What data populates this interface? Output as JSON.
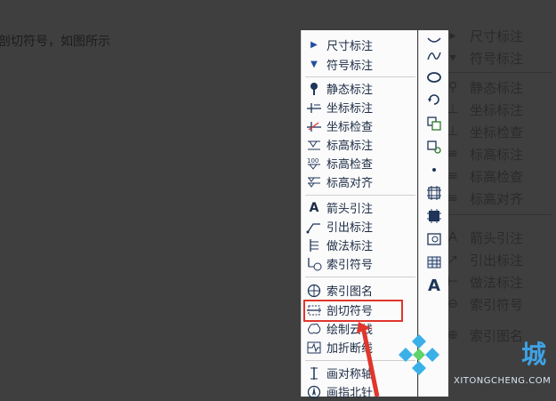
{
  "background_caption": "剖切符号，如图所示",
  "menu": {
    "items": [
      {
        "label": "尺寸标注",
        "icon": "triangle-right-icon"
      },
      {
        "label": "符号标注",
        "icon": "triangle-down-icon"
      },
      {
        "label": "静态标注",
        "icon": "pin-icon"
      },
      {
        "label": "坐标标注",
        "icon": "coordinate-icon"
      },
      {
        "label": "坐标检查",
        "icon": "coordinate-check-icon"
      },
      {
        "label": "标高标注",
        "icon": "elevation-icon"
      },
      {
        "label": "标高检查",
        "icon": "elevation-check-icon"
      },
      {
        "label": "标高对齐",
        "icon": "elevation-align-icon"
      },
      {
        "label": "箭头引注",
        "icon": "arrow-annotation-icon"
      },
      {
        "label": "引出标注",
        "icon": "leader-icon"
      },
      {
        "label": "做法标注",
        "icon": "method-icon"
      },
      {
        "label": "索引符号",
        "icon": "index-symbol-icon"
      },
      {
        "label": "索引图名",
        "icon": "index-name-icon"
      },
      {
        "label": "剖切符号",
        "icon": "section-symbol-icon"
      },
      {
        "label": "绘制云线",
        "icon": "cloud-line-icon"
      },
      {
        "label": "加折断线",
        "icon": "break-line-icon"
      },
      {
        "label": "画对称轴",
        "icon": "symmetry-axis-icon"
      },
      {
        "label": "画指北针",
        "icon": "north-arrow-icon"
      }
    ],
    "highlighted": "剖切符号",
    "highlight_color": "#e0362c"
  },
  "ghost_menu": {
    "items": [
      "尺寸标注",
      "符号标注",
      "静态标注",
      "坐标标注",
      "坐标检查",
      "标高标注",
      "标高检查",
      "标高对齐",
      "箭头引注",
      "引出标注",
      "做法标注",
      "索引符号",
      "索引图名"
    ]
  },
  "toolbar_strip": {
    "icons": [
      "arc-icon",
      "spline-icon",
      "ellipse-icon",
      "rotate-icon",
      "copy-icon",
      "move-icon",
      "dot-icon",
      "hatch-icon",
      "grid-icon",
      "view-icon",
      "table-icon",
      "text-icon"
    ],
    "text_glyph": "A"
  },
  "watermark": {
    "big": "城",
    "small": "XITONGCHENG.COM",
    "color": "#3ea2e6"
  }
}
